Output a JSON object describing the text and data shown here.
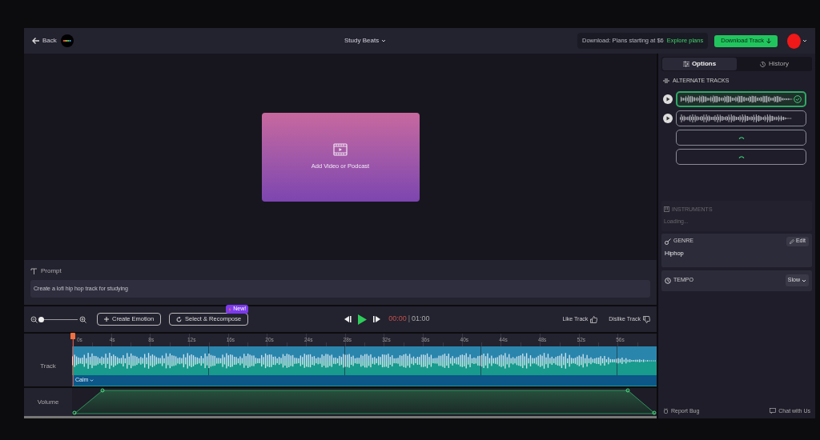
{
  "header": {
    "back": "Back",
    "title": "Study Beats",
    "promo": "Download: Plans starting at $6",
    "promo_link": "Explore plans",
    "download": "Download Track"
  },
  "video": {
    "add_label": "Add Video or Podcast"
  },
  "prompt": {
    "label": "Prompt",
    "value": "Create a lofi hip hop track for studying"
  },
  "controls": {
    "zoom": {
      "level": 0.05
    },
    "create_emotion": "Create Emotion",
    "recompose": "Select & Recompose",
    "badge": "New!",
    "current_time": "00:00",
    "separator": "|",
    "total_time": "01:00",
    "like": "Like Track",
    "dislike": "Dislike Track"
  },
  "timeline": {
    "ticks": [
      "0s",
      "4s",
      "8s",
      "12s",
      "16s",
      "20s",
      "24s",
      "28s",
      "32s",
      "36s",
      "40s",
      "44s",
      "48s",
      "52s",
      "56s"
    ],
    "track_label": "Track",
    "emotion": "Calm",
    "volume_label": "Volume"
  },
  "sidebar": {
    "tabs": [
      {
        "label": "Options",
        "selected": true
      },
      {
        "label": "History",
        "selected": false
      }
    ],
    "alternate_tracks": {
      "title": "ALTERNATE TRACKS",
      "tracks": [
        {
          "kind": "waveform",
          "selected": true
        },
        {
          "kind": "waveform",
          "selected": false
        },
        {
          "kind": "loading",
          "selected": false
        },
        {
          "kind": "loading",
          "selected": false
        }
      ]
    },
    "instruments": {
      "title": "INSTRUMENTS",
      "status": "Loading..."
    },
    "genre": {
      "title": "GENRE",
      "value": "Hiphop",
      "edit": "Edit"
    },
    "tempo": {
      "title": "TEMPO",
      "value": "Slow"
    },
    "footer": {
      "report": "Report Bug",
      "chat": "Chat with Us"
    }
  }
}
